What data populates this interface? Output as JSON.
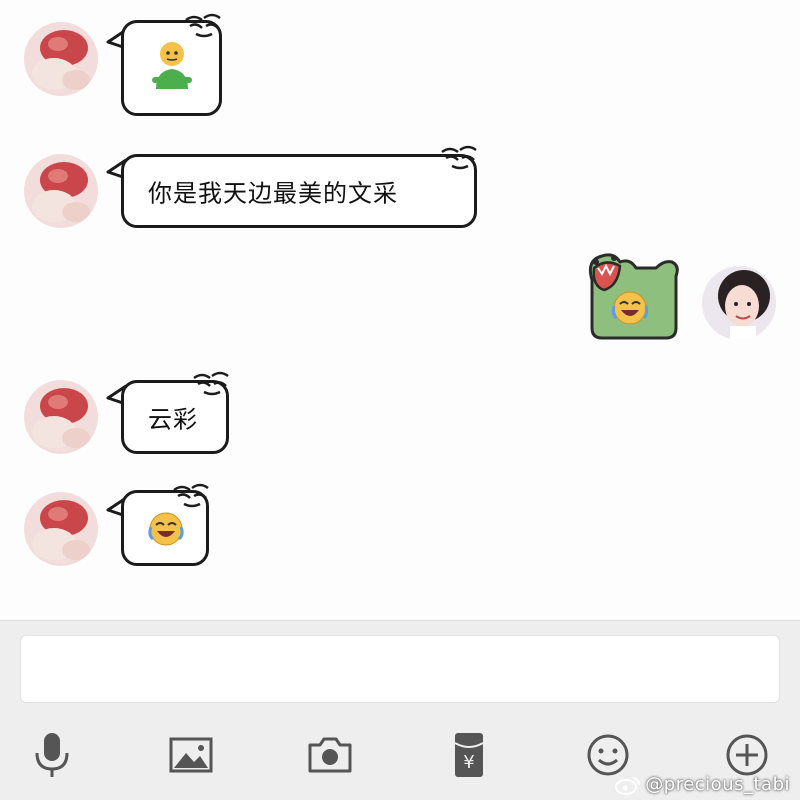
{
  "conversation": {
    "messages": [
      {
        "sender": "friend",
        "type": "emoji",
        "emoji": "standing-person-emoji"
      },
      {
        "sender": "friend",
        "type": "text",
        "text": "你是我天边最美的文采"
      },
      {
        "sender": "me",
        "type": "sticker",
        "sticker": "green-monster-laughing-sticker"
      },
      {
        "sender": "friend",
        "type": "text",
        "text": "云彩"
      },
      {
        "sender": "friend",
        "type": "emoji",
        "emoji": "tears-of-joy-emoji"
      }
    ]
  },
  "composer": {
    "input_value": "",
    "toolbar_icons": [
      "microphone-icon",
      "image-icon",
      "camera-icon",
      "red-packet-icon",
      "smiley-icon",
      "plus-icon"
    ]
  },
  "watermark": {
    "text": "@precious_tabi"
  },
  "colors": {
    "background": "#fdfdfd",
    "bubble_border": "#1b1b1b",
    "toolbar_icon": "#555555",
    "composer_bg": "#eeeeee",
    "sticker_green": "#8fbf7f"
  }
}
